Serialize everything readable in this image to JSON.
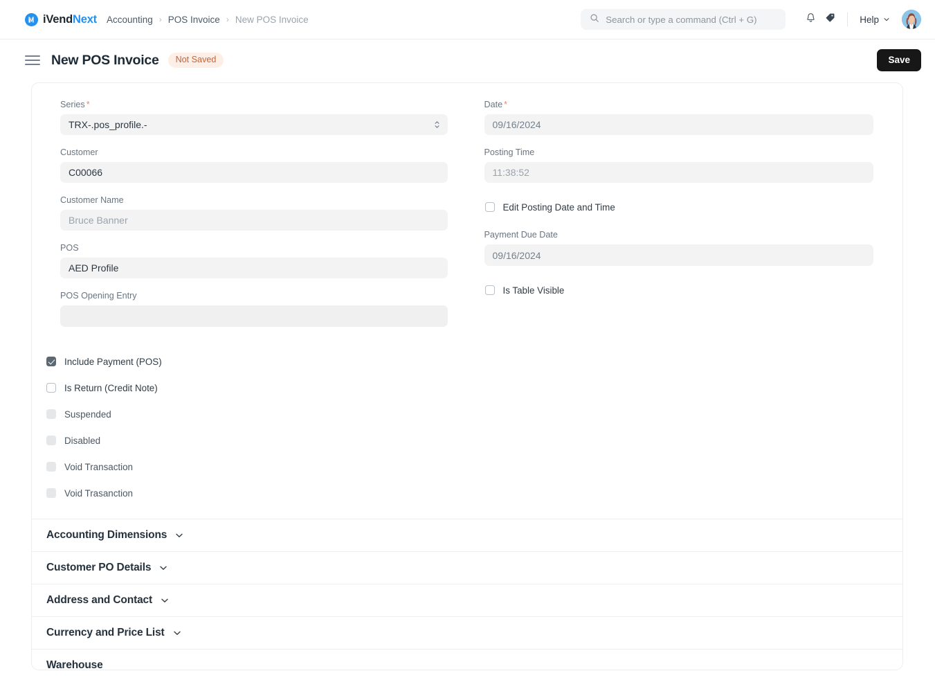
{
  "navbar": {
    "brand": {
      "primary": "iVend",
      "accent": "Next",
      "icon": "ivend-logo-icon"
    },
    "breadcrumbs": [
      {
        "label": "Accounting",
        "muted": false
      },
      {
        "label": "POS Invoice",
        "muted": false
      },
      {
        "label": "New POS Invoice",
        "muted": true
      }
    ],
    "separator": "›",
    "search": {
      "placeholder": "Search or type a command (Ctrl + G)",
      "value": ""
    },
    "notifications_icon": "bell-icon",
    "tag_icon": "tag-icon",
    "help_label": "Help",
    "help_chevron": "chevron-down-icon",
    "avatar": "user-avatar"
  },
  "page_header": {
    "menu_icon": "hamburger-icon",
    "title": "New POS Invoice",
    "status_badge": "Not Saved",
    "save_label": "Save"
  },
  "form": {
    "left": {
      "series": {
        "label": "Series",
        "required": "*",
        "value": "TRX-.pos_profile.-",
        "stepper_icon": "stepper-updown-icon"
      },
      "customer": {
        "label": "Customer",
        "value": "C00066"
      },
      "customer_name": {
        "label": "Customer Name",
        "value": "Bruce Banner"
      },
      "pos": {
        "label": "POS",
        "value": "AED Profile"
      },
      "pos_opening_entry": {
        "label": "POS Opening Entry",
        "value": ""
      }
    },
    "right": {
      "date": {
        "label": "Date",
        "required": "*",
        "value": "09/16/2024"
      },
      "posting_time": {
        "label": "Posting Time",
        "value": "11:38:52"
      },
      "payment_due_date": {
        "label": "Payment Due Date",
        "value": "09/16/2024"
      }
    },
    "left_checkboxes": [
      {
        "label": "Include Payment (POS)",
        "checked": true,
        "disabled": false
      },
      {
        "label": "Is Return (Credit Note)",
        "checked": false,
        "disabled": false
      },
      {
        "label": "Suspended",
        "checked": false,
        "disabled": true
      },
      {
        "label": "Disabled",
        "checked": false,
        "disabled": true
      },
      {
        "label": "Void Transaction",
        "checked": false,
        "disabled": true
      },
      {
        "label": "Void Trasanction",
        "checked": false,
        "disabled": true
      }
    ],
    "right_checkboxes": [
      {
        "label": "Edit Posting Date and Time",
        "checked": false,
        "disabled": false
      },
      {
        "label": "Is Table Visible",
        "checked": false,
        "disabled": false
      }
    ]
  },
  "sections": [
    {
      "title": "Accounting Dimensions",
      "chevron": "chevron-down-icon",
      "has_chevron": true
    },
    {
      "title": "Customer PO Details",
      "chevron": "chevron-down-icon",
      "has_chevron": true
    },
    {
      "title": "Address and Contact",
      "chevron": "chevron-down-icon",
      "has_chevron": true
    },
    {
      "title": "Currency and Price List",
      "chevron": "chevron-down-icon",
      "has_chevron": true
    },
    {
      "title": "Warehouse",
      "chevron": "",
      "has_chevron": false
    }
  ],
  "colors": {
    "accent_blue": "#2490ef",
    "badge_bg": "#fdefe6",
    "badge_text": "#c4643c",
    "save_bg": "#171717",
    "required_asterisk": "#e8836a",
    "field_bg": "#f3f3f4"
  }
}
